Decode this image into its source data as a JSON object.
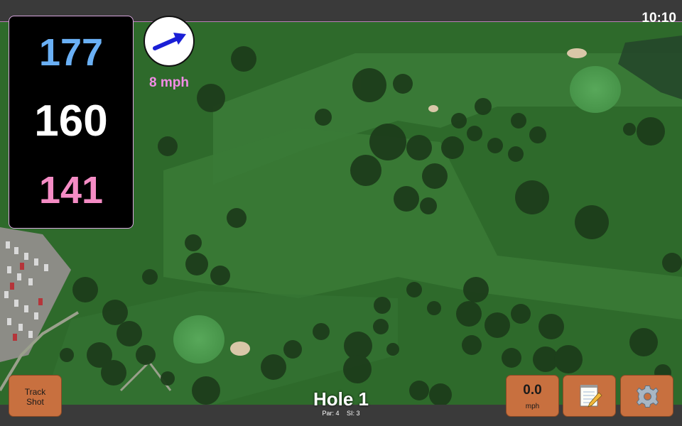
{
  "status_bar": {
    "time": "10:10"
  },
  "yardages": {
    "back": {
      "value": "177",
      "color": "#6ab0f5"
    },
    "middle": {
      "value": "160",
      "color": "#ffffff"
    },
    "front": {
      "value": "141",
      "color": "#f58cc5"
    }
  },
  "wind": {
    "speed": "8 mph",
    "speed_color": "#f28ce6",
    "arrow_icon": "wind-direction-arrow-icon",
    "arrow_color": "#1a1fd6"
  },
  "hole": {
    "title": "Hole 1",
    "par": "Par: 4",
    "stroke_index": "SI: 3"
  },
  "buttons": {
    "track_shot": [
      "Track",
      "Shot"
    ],
    "speed": {
      "value": "0.0",
      "unit": "mph"
    },
    "notes_icon": "notepad-icon",
    "settings_icon": "gear-icon",
    "color": "#c8703f"
  }
}
